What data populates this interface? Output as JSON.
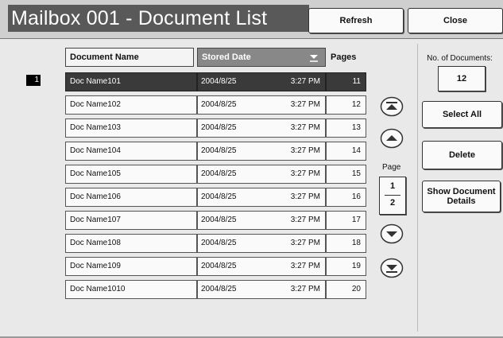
{
  "header": {
    "title": "Mailbox 001 - Document List",
    "refresh_label": "Refresh",
    "close_label": "Close"
  },
  "table": {
    "selected_index": "1",
    "columns": {
      "name": "Document Name",
      "date": "Stored Date",
      "pages": "Pages"
    },
    "sort_icon": "chevron-down-icon",
    "rows": [
      {
        "name": "Doc Name101",
        "date": "2004/8/25",
        "time": "3:27 PM",
        "pages": "11",
        "selected": true
      },
      {
        "name": "Doc Name102",
        "date": "2004/8/25",
        "time": "3:27 PM",
        "pages": "12"
      },
      {
        "name": "Doc Name103",
        "date": "2004/8/25",
        "time": "3:27 PM",
        "pages": "13"
      },
      {
        "name": "Doc Name104",
        "date": "2004/8/25",
        "time": "3:27 PM",
        "pages": "14"
      },
      {
        "name": "Doc Name105",
        "date": "2004/8/25",
        "time": "3:27 PM",
        "pages": "15"
      },
      {
        "name": "Doc Name106",
        "date": "2004/8/25",
        "time": "3:27 PM",
        "pages": "16"
      },
      {
        "name": "Doc Name107",
        "date": "2004/8/25",
        "time": "3:27 PM",
        "pages": "17"
      },
      {
        "name": "Doc Name108",
        "date": "2004/8/25",
        "time": "3:27 PM",
        "pages": "18"
      },
      {
        "name": "Doc Name109",
        "date": "2004/8/25",
        "time": "3:27 PM",
        "pages": "19"
      },
      {
        "name": "Doc Name1010",
        "date": "2004/8/25",
        "time": "3:27 PM",
        "pages": "20"
      }
    ]
  },
  "pager": {
    "label": "Page",
    "current": "1",
    "total": "2",
    "icons": [
      "first-page-icon",
      "previous-page-icon",
      "next-page-icon",
      "last-page-icon"
    ]
  },
  "side": {
    "count_label": "No. of Documents:",
    "count": "12",
    "select_all_label": "Select All",
    "delete_label": "Delete",
    "details_label": "Show Document Details"
  },
  "colors": {
    "title_bg": "#595959",
    "selected_row": "#3a3a3a",
    "sorted_header": "#888888"
  }
}
